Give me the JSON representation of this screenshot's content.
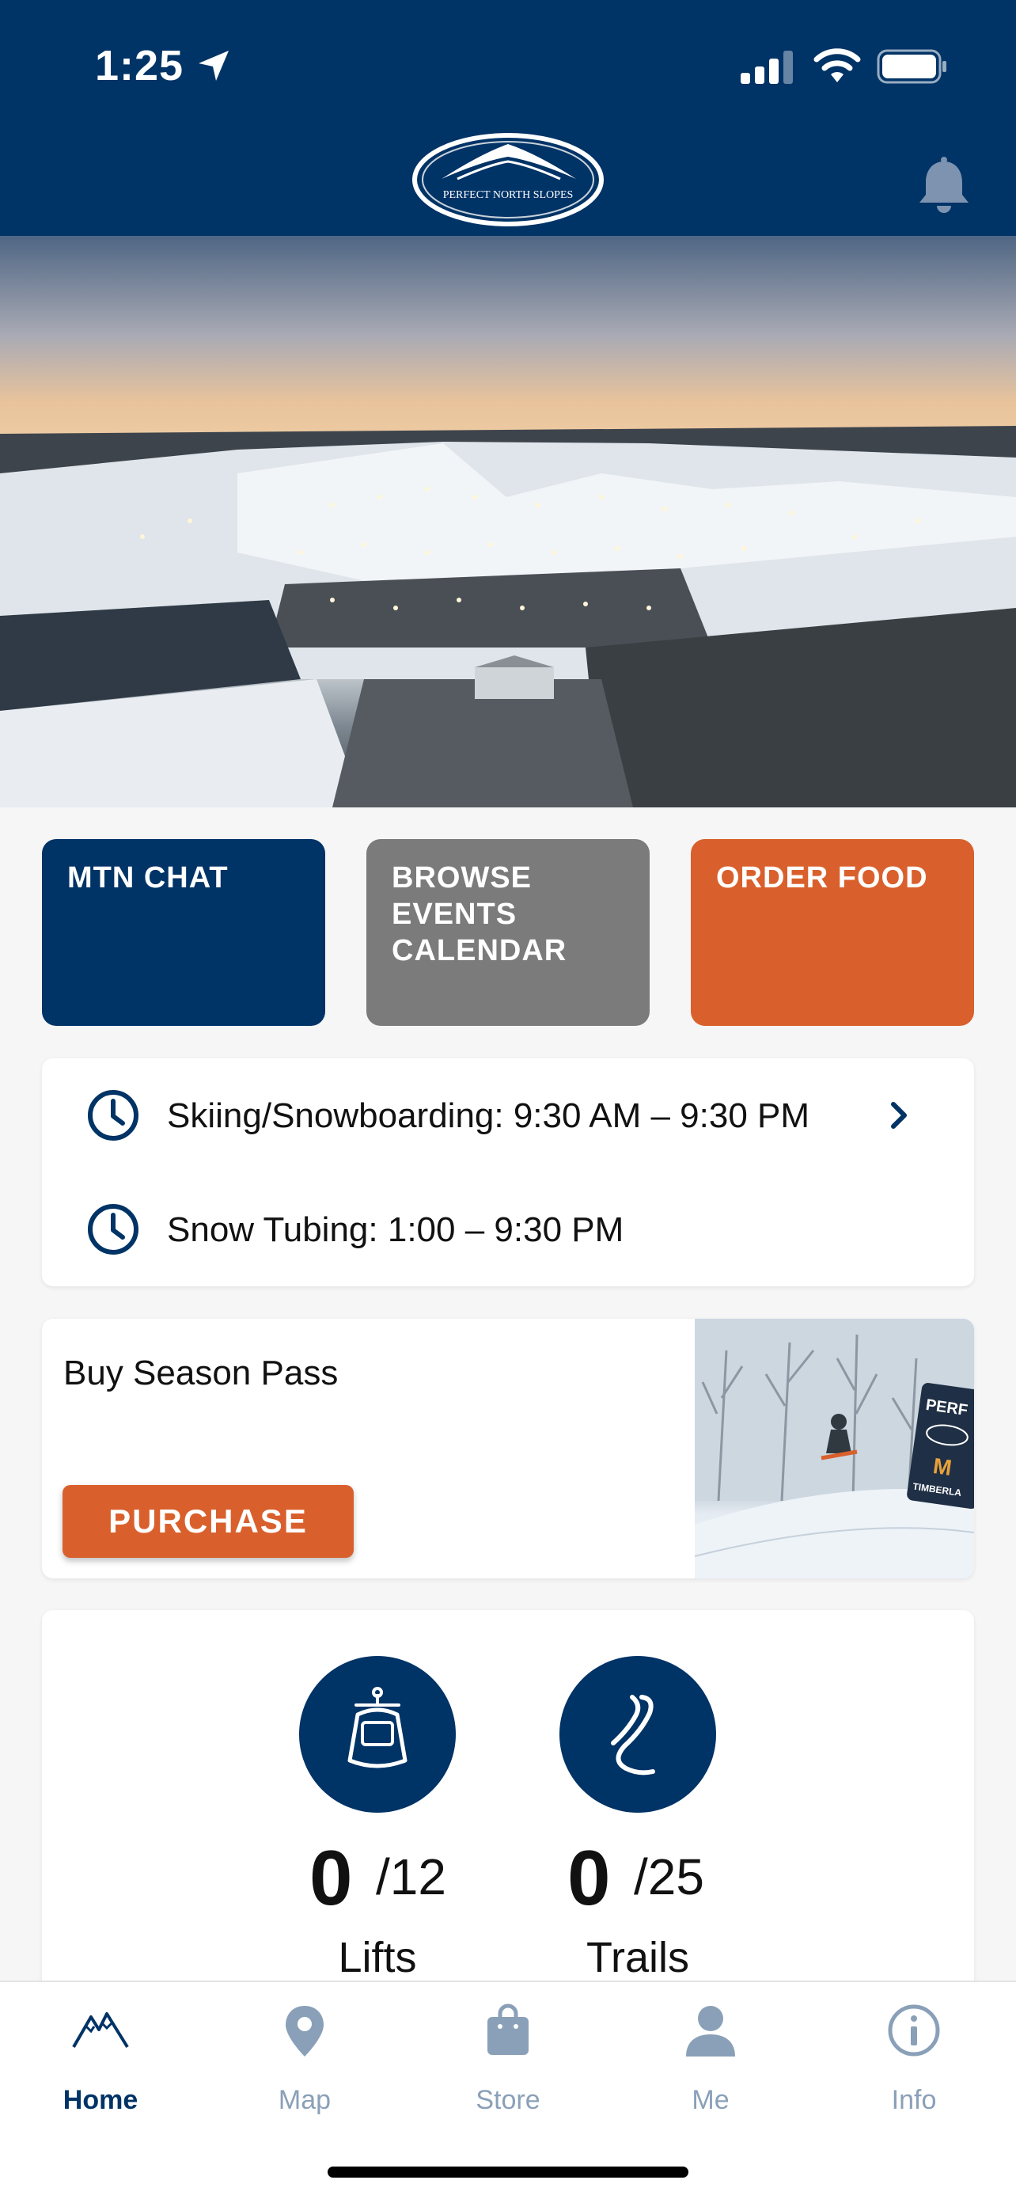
{
  "status_bar": {
    "time": "1:25"
  },
  "header": {
    "logo_text": "PERFECT NORTH SLOPES"
  },
  "tiles": [
    {
      "label": "MTN CHAT"
    },
    {
      "label": "BROWSE EVENTS CALENDAR"
    },
    {
      "label": "ORDER FOOD"
    }
  ],
  "hours": {
    "rows": [
      {
        "label": "Skiing/Snowboarding: 9:30 AM – 9:30 PM"
      },
      {
        "label": "Snow Tubing: 1:00 – 9:30 PM"
      }
    ]
  },
  "season_pass": {
    "title": "Buy Season Pass",
    "button": "PURCHASE"
  },
  "stats": {
    "lifts": {
      "open": "0",
      "total": "/12",
      "label": "Lifts"
    },
    "trails": {
      "open": "0",
      "total": "/25",
      "label": "Trails"
    }
  },
  "tab_bar": {
    "tabs": [
      {
        "label": "Home",
        "icon": "mountain-icon",
        "active": true
      },
      {
        "label": "Map",
        "icon": "map-pin-icon",
        "active": false
      },
      {
        "label": "Store",
        "icon": "shopping-bag-icon",
        "active": false
      },
      {
        "label": "Me",
        "icon": "person-icon",
        "active": false
      },
      {
        "label": "Info",
        "icon": "info-icon",
        "active": false
      }
    ]
  },
  "colors": {
    "brand_navy": "#003366",
    "accent_orange": "#d9602c",
    "tile_gray": "#7b7b7b",
    "tab_inactive": "#8aa0b8"
  }
}
